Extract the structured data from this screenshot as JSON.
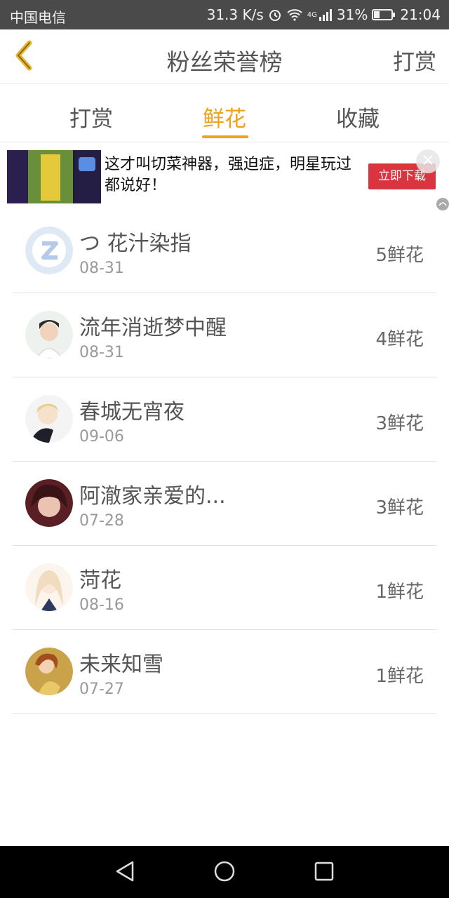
{
  "status_bar": {
    "carrier": "中国电信",
    "speed": "31.3 K/s",
    "network": "4G",
    "battery": "31%",
    "time": "21:04"
  },
  "nav": {
    "title": "粉丝荣誉榜",
    "right_action": "打赏"
  },
  "tabs": [
    {
      "label": "打赏",
      "active": false
    },
    {
      "label": "鲜花",
      "active": true
    },
    {
      "label": "收藏",
      "active": false
    }
  ],
  "ad": {
    "text": "这才叫切菜神器，强迫症，明星玩过都说好！",
    "cta": "立即下载"
  },
  "fans": [
    {
      "name": "つ 花汁染指",
      "date": "08-31",
      "count": "5鲜花"
    },
    {
      "name": "流年消逝梦中醒",
      "date": "08-31",
      "count": "4鲜花"
    },
    {
      "name": "春城无宵夜",
      "date": "09-06",
      "count": "3鲜花"
    },
    {
      "name": "阿澈家亲爱的...",
      "date": "07-28",
      "count": "3鲜花"
    },
    {
      "name": "菏花",
      "date": "08-16",
      "count": "1鲜花"
    },
    {
      "name": "未来知雪",
      "date": "07-27",
      "count": "1鲜花"
    }
  ],
  "colors": {
    "accent": "#f0a21a",
    "status_bar": "#4a4a4a",
    "ad_button": "#d9343f"
  }
}
